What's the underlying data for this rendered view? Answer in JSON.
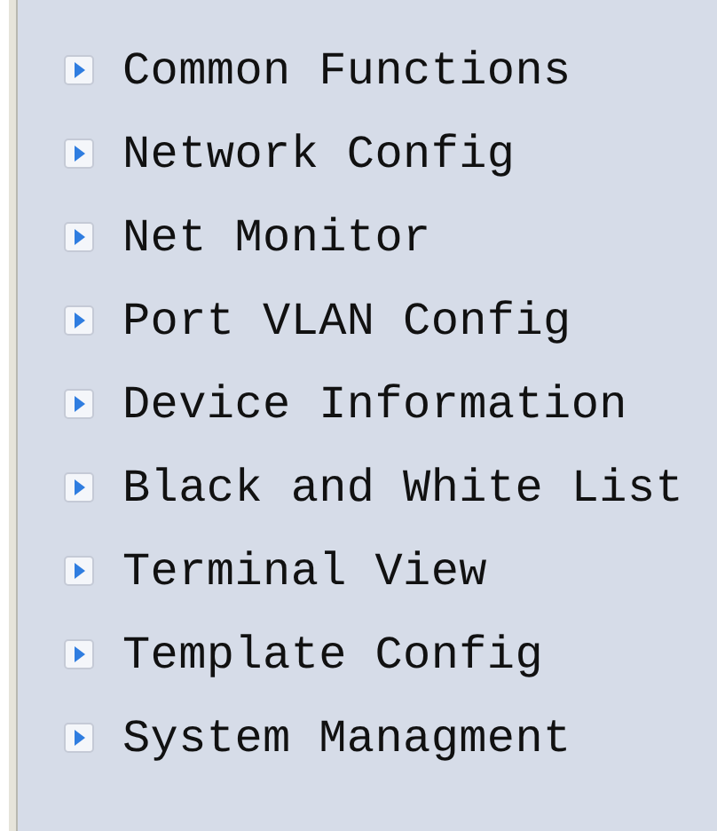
{
  "menu": {
    "items": [
      {
        "label": "Common Functions"
      },
      {
        "label": "Network Config"
      },
      {
        "label": "Net Monitor"
      },
      {
        "label": "Port VLAN Config"
      },
      {
        "label": "Device Information"
      },
      {
        "label": "Black and White List"
      },
      {
        "label": "Terminal View"
      },
      {
        "label": "Template Config"
      },
      {
        "label": "System Managment"
      }
    ]
  }
}
